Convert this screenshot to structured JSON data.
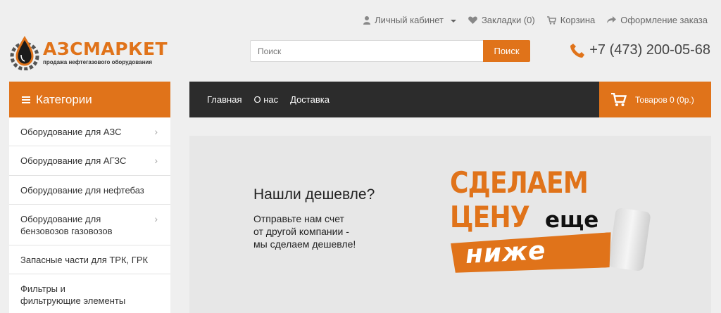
{
  "top_links": {
    "account": "Личный кабинет",
    "wishlist": "Закладки (0)",
    "cart": "Корзина",
    "checkout": "Оформление заказа"
  },
  "logo": {
    "title_part1": "АЗС",
    "title_part2": "МАРКЕТ",
    "subtitle": "продажа нефтегазового оборудования"
  },
  "search": {
    "placeholder": "Поиск",
    "button": "Поиск"
  },
  "phone": "+7 (473) 200-05-68",
  "categories": {
    "title": "Категории",
    "items": [
      {
        "label": "Оборудование для АЗС",
        "has_children": true
      },
      {
        "label": "Оборудование для АГЗС",
        "has_children": true
      },
      {
        "label": "Оборудование для нефтебаз",
        "has_children": false
      },
      {
        "label": "Оборудование для бензовозов газовозов",
        "has_children": true
      },
      {
        "label": "Запасные части для ТРК, ГРК",
        "has_children": false
      },
      {
        "label": "Фильтры и фильтрующие элементы",
        "has_children": false
      }
    ]
  },
  "nav": {
    "items": [
      "Главная",
      "О нас",
      "Доставка"
    ]
  },
  "cart_button": "Товаров 0 (0р.)",
  "banner": {
    "question": "Нашли дешевле?",
    "line1": "Отправьте нам счет",
    "line2": "от другой компании -",
    "line3": "мы сделаем дешевле!",
    "big1": "СДЕЛАЕМ",
    "big2": "ЦЕНУ",
    "big3": "еще",
    "big4": "ниже"
  },
  "colors": {
    "accent": "#e0731a",
    "nav_bg": "#2c2c2c",
    "page_bg": "#efefef"
  }
}
